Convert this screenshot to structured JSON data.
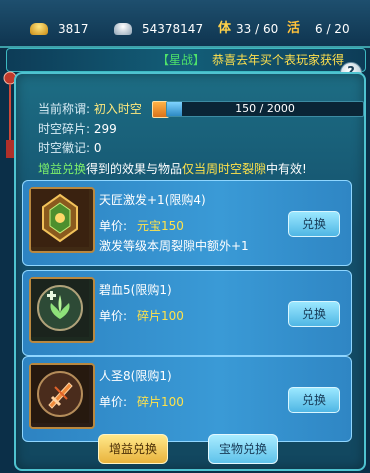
{
  "topbar": {
    "gold": "3817",
    "silver": "54378147",
    "stamina_tag": "体",
    "stamina": "33 / 60",
    "vitality_tag": "活",
    "vitality": "6 / 20"
  },
  "banner": {
    "tag": "【星战】",
    "message": "恭喜去年买个表玩家获得"
  },
  "help_label": "?",
  "status": {
    "rank_label": "当前称谓:",
    "rank_value": "初入时空",
    "progress_text": "150 / 2000",
    "progress_fraction": 0.075,
    "fragments_label": "时空碎片:",
    "fragments_value": "299",
    "emblem_label": "时空徽记:",
    "emblem_value": "0"
  },
  "notice": {
    "part1": "增益兑换",
    "part2": "得到的效果与物品",
    "part3": "仅当周时空裂隙",
    "part4": "中有效!"
  },
  "items": [
    {
      "name": "天匠激发+1(限购4)",
      "price_label": "单价:",
      "price": "元宝150",
      "desc": "激发等级本周裂隙中额外+1",
      "button": "兑换",
      "icon": "medal-icon"
    },
    {
      "name": "碧血5(限购1)",
      "price_label": "单价:",
      "price": "碎片100",
      "desc": "",
      "button": "兑换",
      "icon": "lotus-heal-icon"
    },
    {
      "name": "人圣8(限购1)",
      "price_label": "单价:",
      "price": "碎片100",
      "desc": "",
      "button": "兑换",
      "icon": "sword-icon"
    }
  ],
  "tabs": {
    "boost": "增益兑换",
    "treasure": "宝物兑换"
  }
}
